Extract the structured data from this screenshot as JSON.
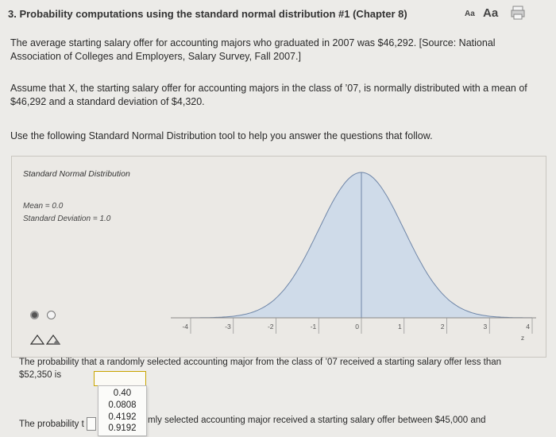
{
  "header": {
    "title": "3. Probability computations using the standard normal distribution #1 (Chapter 8)",
    "font_small_label": "Aa",
    "font_large_label": "Aa",
    "print_icon": "print-icon"
  },
  "content": {
    "intro": "The average starting salary offer for accounting majors who graduated in 2007 was $46,292. [Source: National Association of Colleges and Employers, Salary Survey, Fall 2007.]",
    "assumption": "Assume that X, the starting salary offer for accounting majors in the class of ’07, is normally distributed with a mean of $46,292 and a standard deviation of $4,320.",
    "instruction": "Use the following Standard Normal Distribution tool to help you answer the questions that follow."
  },
  "tool": {
    "title": "Standard Normal Distribution",
    "mean_label": "Mean = 0.0",
    "sd_label": "Standard Deviation = 1.0",
    "axis_label": "z",
    "ticks": [
      "-4",
      "-3",
      "-2",
      "-1",
      "0",
      "1",
      "2",
      "3",
      "4"
    ],
    "mean": 0.0,
    "sd": 1.0,
    "radio_selected": 0,
    "colors": {
      "curve_fill": "#cfdbe9",
      "curve_line": "#6f86a8"
    }
  },
  "questions": {
    "q1_text": "The probability that a randomly selected accounting major from the class of ’07 received a starting salary offer less than $52,350 is",
    "q1_options": [
      "0.40",
      "0.0808",
      "0.4192",
      "0.9192"
    ],
    "q2_start": "The probability t",
    "q2_rest": "mly selected accounting major received a starting salary offer between $45,000 and"
  }
}
